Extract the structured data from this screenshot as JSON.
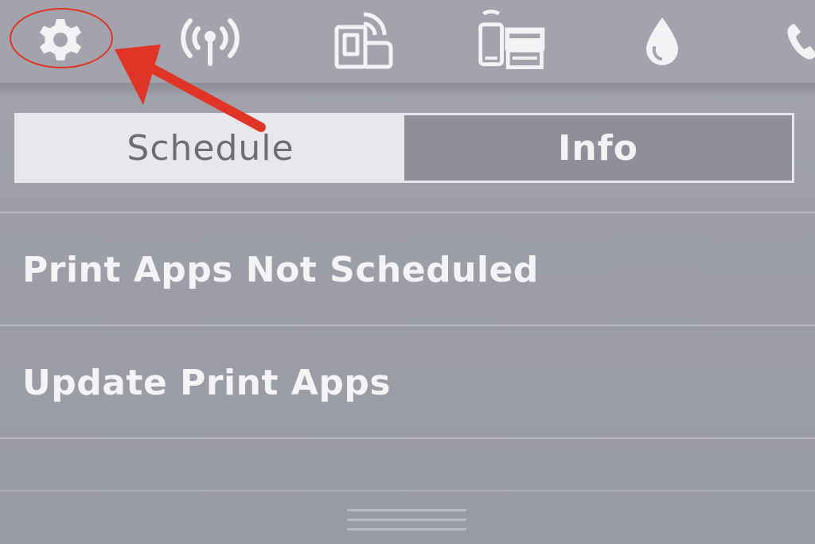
{
  "topbar": {
    "icons": [
      {
        "name": "gear-icon",
        "label": "Setup"
      },
      {
        "name": "wireless-icon",
        "label": "Wireless"
      },
      {
        "name": "wifi-direct-icon",
        "label": "Wi-Fi Direct"
      },
      {
        "name": "mobile-print-icon",
        "label": "Mobile Print"
      },
      {
        "name": "ink-drop-icon",
        "label": "Ink"
      },
      {
        "name": "phone-fax-icon",
        "label": "Fax"
      }
    ]
  },
  "annotation": {
    "color": "#e03426"
  },
  "tabs": [
    {
      "label": "Schedule",
      "active": true
    },
    {
      "label": "Info",
      "active": false
    }
  ],
  "list": {
    "items": [
      {
        "label": "Print Apps Not Scheduled"
      },
      {
        "label": "Update Print Apps"
      }
    ]
  },
  "colors": {
    "background": "#9b9ca6",
    "tab_active_bg": "#e7e8eb",
    "tab_inactive_bg": "#8e8f9a",
    "text_light": "#f4f4f6"
  }
}
